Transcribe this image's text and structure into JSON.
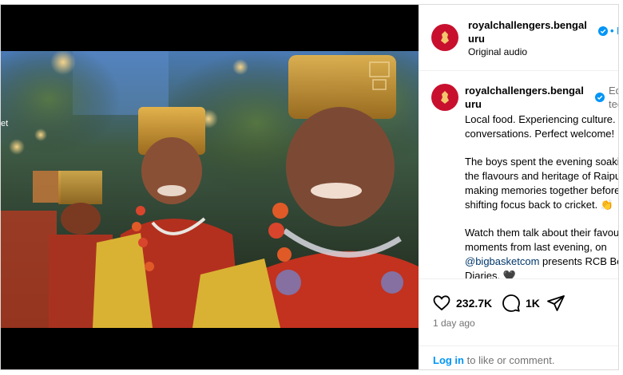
{
  "video": {
    "edge_text": "et"
  },
  "header": {
    "username_line1": "royalchallengers.bengal",
    "username_line2": "uru",
    "follow_label": "• F",
    "audio": "Original audio"
  },
  "comment": {
    "username_line1": "royalchallengers.bengal",
    "username_line2": "uru",
    "edited": "Edited",
    "p1": "Local food. Experiencing culture.\nconversations. Perfect welcome!",
    "p2": "The boys spent the evening soaking\nthe flavours and heritage of Raipur,\nmaking memories together before\nshifting focus back to cricket. 👏",
    "p3_pre": "Watch them talk about their favourite\nmoments from last evening, on\n",
    "p3_mention": "@bigbasketcom",
    "p3_post": " presents RCB Bold\nDiaries. 🖤"
  },
  "actions": {
    "likes": "232.7K",
    "comments": "1K",
    "time": "1 day ago"
  },
  "login": {
    "link": "Log in",
    "rest": "to like or comment."
  },
  "colors": {
    "brand_red": "#c8102e",
    "verified_blue": "#0095f6",
    "link_blue": "#0095f6"
  }
}
